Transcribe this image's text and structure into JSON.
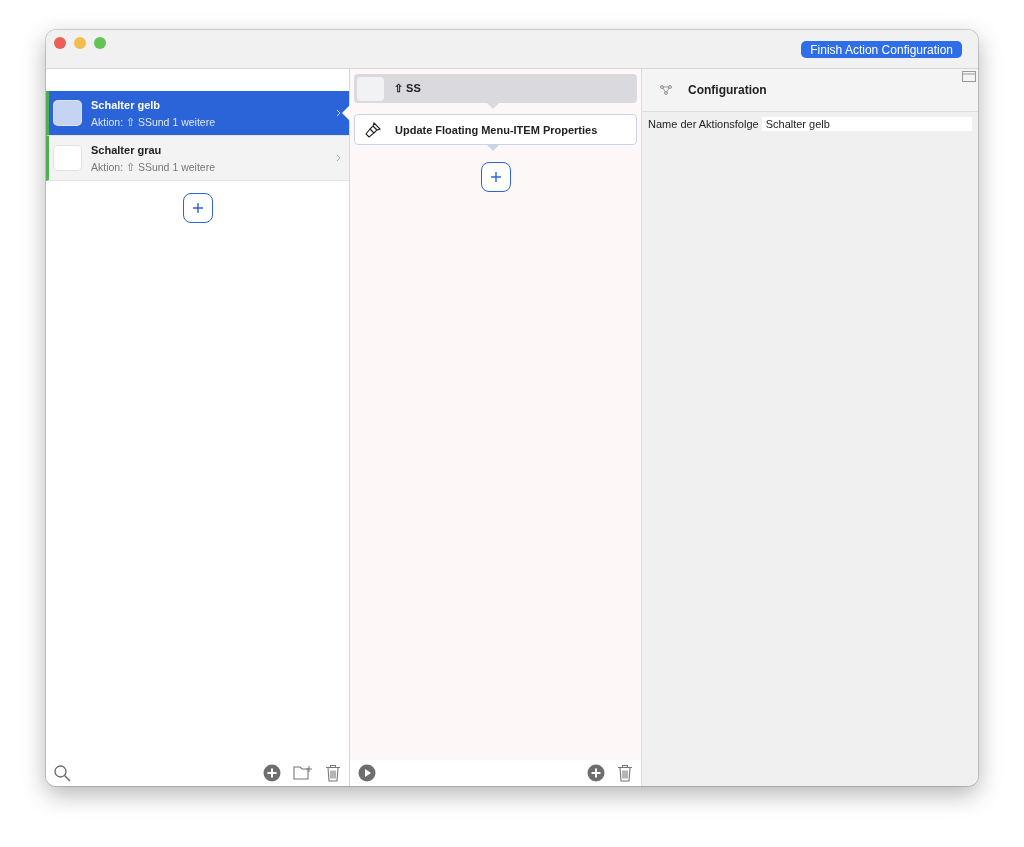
{
  "toolbar": {
    "finish_button": "Finish Action Configuration"
  },
  "sequences": [
    {
      "name": "Schalter gelb",
      "subtitle": "Aktion: ⇧ SSund 1 weitere",
      "selected": true
    },
    {
      "name": "Schalter grau",
      "subtitle": "Aktion: ⇧ SSund 1 weitere",
      "selected": false
    }
  ],
  "actions": [
    {
      "kind": "trigger",
      "label": "⇧ SS"
    },
    {
      "kind": "action",
      "label": "Update Floating Menu-ITEM Properties"
    }
  ],
  "configuration": {
    "title": "Configuration",
    "fields": [
      {
        "label": "Name der Aktionsfolge",
        "value": "Schalter gelb"
      }
    ]
  }
}
